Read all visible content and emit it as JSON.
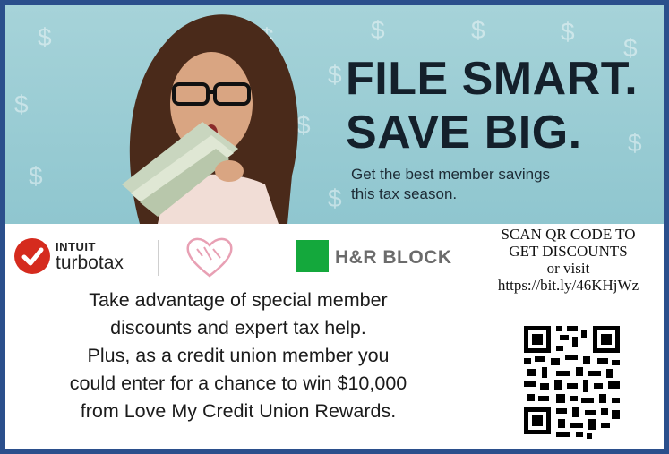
{
  "headline": {
    "line1": "FILE SMART.",
    "line2": "SAVE BIG."
  },
  "subline": {
    "line1": "Get the best member savings",
    "line2": "this tax season."
  },
  "logos": {
    "turbotax_brand": "INTUIT",
    "turbotax_name": "turbotax",
    "hrblock_name": "H&R BLOCK"
  },
  "body_copy": [
    "Take advantage of special member",
    "discounts and expert tax help.",
    "Plus, as a credit union member you",
    "could enter for a chance to win $10,000",
    "from Love My Credit Union Rewards."
  ],
  "qr_panel": {
    "line1": "SCAN QR CODE TO",
    "line2": "GET DISCOUNTS",
    "line3": "or visit",
    "url": "https://bit.ly/46KHjWz"
  },
  "colors": {
    "frame": "#2b4f8c",
    "hero_bg": "#a6d3d9",
    "turbotax_red": "#d52b1e",
    "hrblock_green": "#14a83c",
    "lmcu_pink": "#e8a0b4"
  }
}
